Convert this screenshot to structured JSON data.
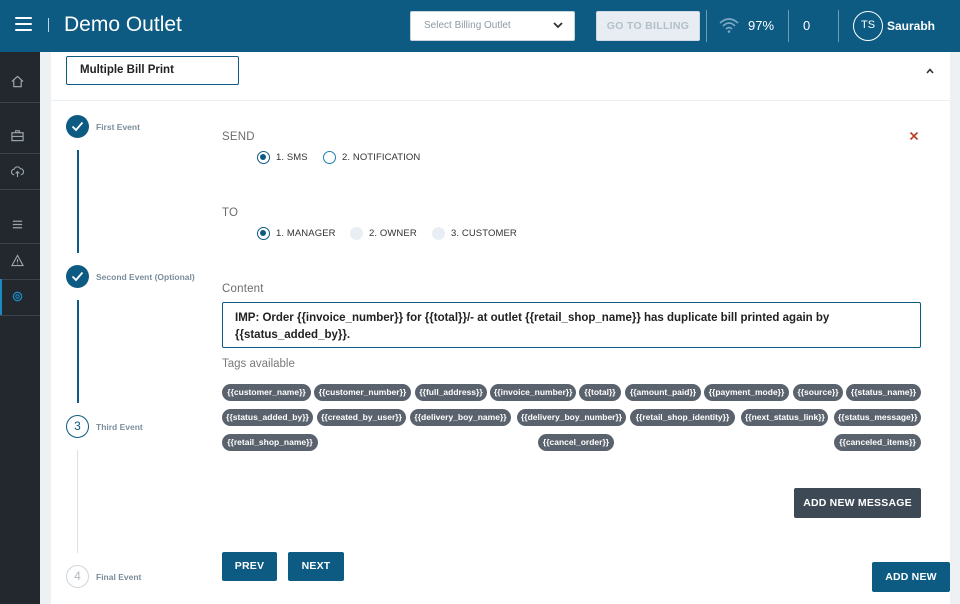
{
  "topbar": {
    "title": "Demo Outlet",
    "outlet_placeholder": "Select Billing Outlet",
    "goto_billing_label": "GO TO BILLING",
    "battery": "97%",
    "notification_count": "0",
    "user_initials": "TS",
    "user_name": "Saurabh"
  },
  "sidebar": {
    "items": [
      "home-icon",
      "briefcase-icon",
      "cloud-upload-icon",
      "list-icon",
      "warning-icon",
      "settings-icon"
    ],
    "active_index": 5
  },
  "form": {
    "name_value": "Multiple Bill Print",
    "steps": [
      {
        "label": "First Event",
        "state": "done"
      },
      {
        "label": "Second Event (Optional)",
        "state": "done"
      },
      {
        "number": "3",
        "label": "Third Event",
        "state": "current"
      },
      {
        "number": "4",
        "label": "Final Event",
        "state": "pending"
      }
    ],
    "send": {
      "label": "SEND",
      "options": [
        "1. SMS",
        "2. NOTIFICATION"
      ],
      "selected": "1. SMS"
    },
    "to": {
      "label": "TO",
      "options": [
        "1. MANAGER",
        "2. OWNER",
        "3. CUSTOMER"
      ],
      "selected": "1. MANAGER"
    },
    "content": {
      "label": "Content",
      "value": "IMP: Order {{invoice_number}} for {{total}}/- at outlet {{retail_shop_name}} has duplicate bill printed again by {{status_added_by}}."
    },
    "tags_label": "Tags available",
    "tags": [
      "{{customer_name}}",
      "{{customer_number}}",
      "{{full_address}}",
      "{{invoice_number}}",
      "{{total}}",
      "{{amount_paid}}",
      "{{payment_mode}}",
      "{{source}}",
      "{{status_name}}",
      "{{status_added_by}}",
      "{{created_by_user}}",
      "{{delivery_boy_name}}",
      "{{delivery_boy_number}}",
      "{{retail_shop_identity}}",
      "{{next_status_link}}",
      "{{status_message}}",
      "{{retail_shop_name}}",
      "{{cancel_order}}",
      "{{canceled_items}}"
    ],
    "add_message_label": "ADD NEW MESSAGE",
    "prev_label": "PREV",
    "next_label": "NEXT",
    "add_new_label": "ADD NEW"
  },
  "colors": {
    "primary": "#0d5a82",
    "sidebar": "#22282e",
    "tag": "#5a636d",
    "close": "#c0392b"
  }
}
